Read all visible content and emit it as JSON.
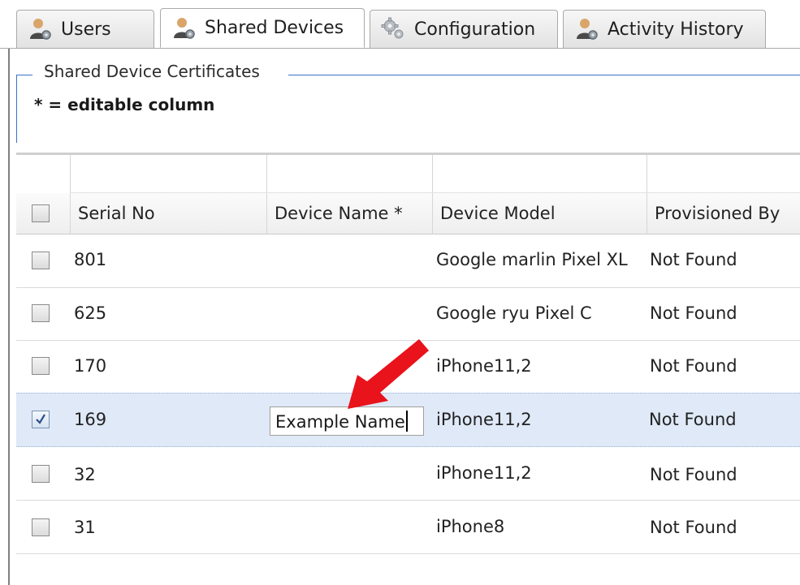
{
  "tabs": [
    {
      "label": "Users",
      "icon": "user-gear-icon",
      "active": false
    },
    {
      "label": "Shared Devices",
      "icon": "user-gear-icon",
      "active": true
    },
    {
      "label": "Configuration",
      "icon": "gears-icon",
      "active": false
    },
    {
      "label": "Activity History",
      "icon": "user-gear-icon",
      "active": false
    }
  ],
  "panel": {
    "legend": "Shared Device Certificates",
    "hint": "* = editable column"
  },
  "grid": {
    "columns": [
      "Serial No",
      "Device Name *",
      "Device Model",
      "Provisioned By"
    ],
    "rows": [
      {
        "serial": "801",
        "name": "",
        "model": "Google marlin Pixel XL",
        "provisioned": "Not Found",
        "checked": false
      },
      {
        "serial": "625",
        "name": "",
        "model": "Google ryu Pixel C",
        "provisioned": "Not Found",
        "checked": false
      },
      {
        "serial": "170",
        "name": "",
        "model": "iPhone11,2",
        "provisioned": "Not Found",
        "checked": false
      },
      {
        "serial": "169",
        "name": "Example Name",
        "model": "iPhone11,2",
        "provisioned": "Not Found",
        "checked": true
      },
      {
        "serial": "32",
        "name": "",
        "model": "iPhone11,2",
        "provisioned": "Not Found",
        "checked": false
      },
      {
        "serial": "31",
        "name": "",
        "model": "iPhone8",
        "provisioned": "Not Found",
        "checked": false
      }
    ]
  },
  "colors": {
    "accent": "#3a72c9",
    "selected_row": "#dfe9f7",
    "arrow": "#e8131b"
  }
}
